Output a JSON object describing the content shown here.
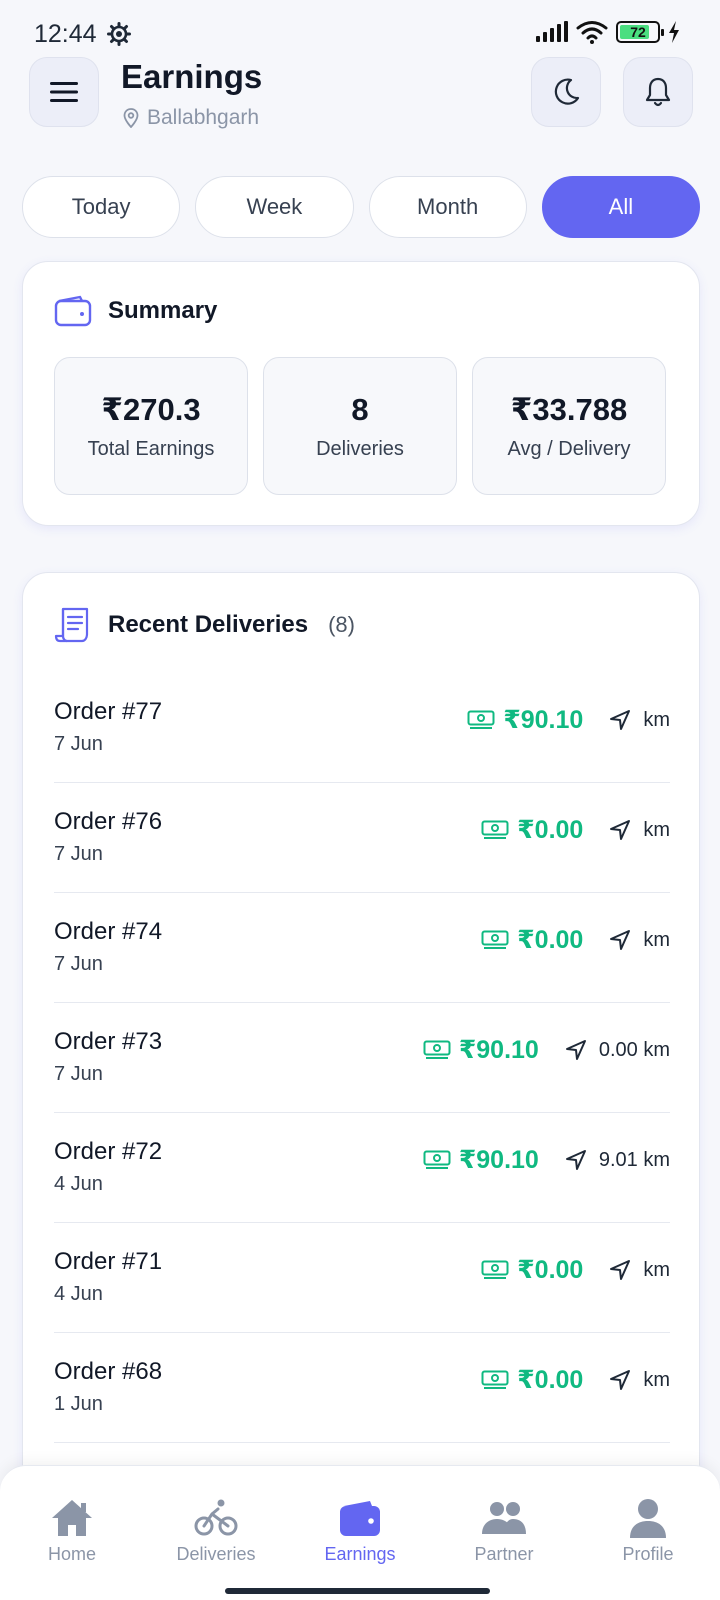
{
  "status_bar": {
    "time": "12:44",
    "battery": "72"
  },
  "header": {
    "title": "Earnings",
    "location": "Ballabhgarh"
  },
  "filters": [
    {
      "label": "Today",
      "active": false
    },
    {
      "label": "Week",
      "active": false
    },
    {
      "label": "Month",
      "active": false
    },
    {
      "label": "All",
      "active": true
    }
  ],
  "summary": {
    "title": "Summary",
    "stats": [
      {
        "value": "₹270.3",
        "label": "Total Earnings"
      },
      {
        "value": "8",
        "label": "Deliveries"
      },
      {
        "value": "₹33.788",
        "label": "Avg / Delivery"
      }
    ]
  },
  "recent": {
    "title": "Recent Deliveries",
    "count": "(8)",
    "orders": [
      {
        "order": "Order #77",
        "date": "7 Jun",
        "amount": "₹90.10",
        "distance": "km"
      },
      {
        "order": "Order #76",
        "date": "7 Jun",
        "amount": "₹0.00",
        "distance": "km"
      },
      {
        "order": "Order #74",
        "date": "7 Jun",
        "amount": "₹0.00",
        "distance": "km"
      },
      {
        "order": "Order #73",
        "date": "7 Jun",
        "amount": "₹90.10",
        "distance": "0.00 km"
      },
      {
        "order": "Order #72",
        "date": "4 Jun",
        "amount": "₹90.10",
        "distance": "9.01 km"
      },
      {
        "order": "Order #71",
        "date": "4 Jun",
        "amount": "₹0.00",
        "distance": "km"
      },
      {
        "order": "Order #68",
        "date": "1 Jun",
        "amount": "₹0.00",
        "distance": "km"
      }
    ]
  },
  "nav": {
    "home": "Home",
    "deliveries": "Deliveries",
    "earnings": "Earnings",
    "partner": "Partner",
    "profile": "Profile"
  },
  "colors": {
    "accent": "#6366f1",
    "money": "#10b981"
  }
}
